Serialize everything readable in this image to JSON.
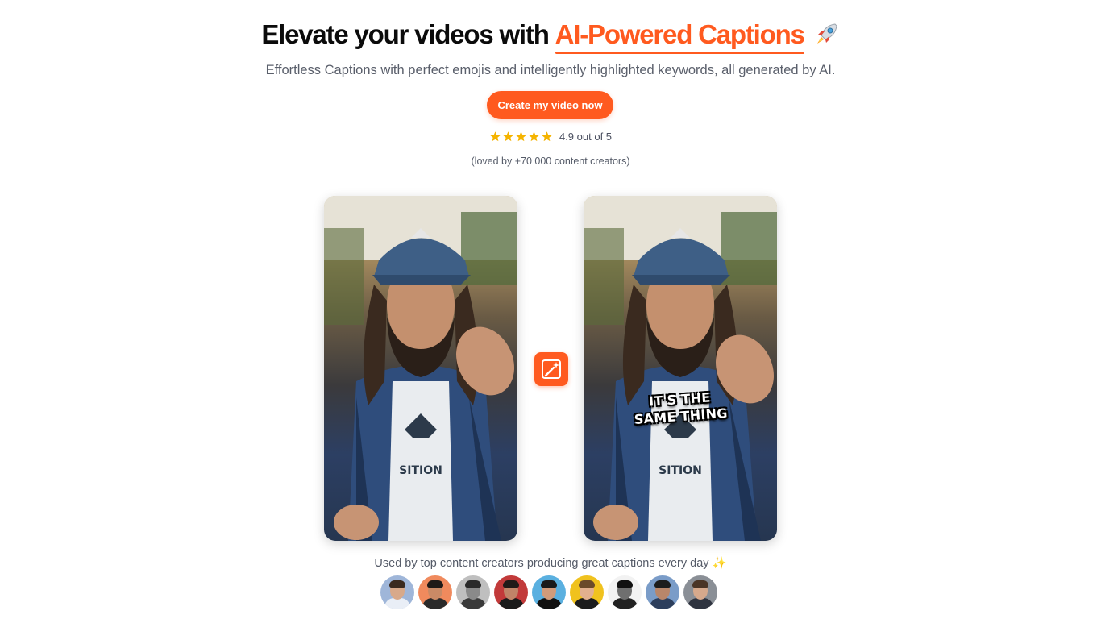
{
  "hero": {
    "title_prefix": "Elevate your videos with ",
    "title_accent": "AI-Powered Captions",
    "subtitle": "Effortless Captions with perfect emojis and intelligently highlighted keywords, all generated by AI."
  },
  "cta": {
    "label": "Create my video now"
  },
  "rating": {
    "stars": 5,
    "text": "4.9 out of 5",
    "loved_text": "(loved by +70 000 content creators)"
  },
  "videos": {
    "after_caption_line1": "IT'S THE",
    "after_caption_line2": "SAME THING"
  },
  "social_proof": {
    "text": "Used by top content creators producing great captions every day ✨",
    "avatars": [
      {
        "bg": "#9fb6d9",
        "skin": "#d8a98a",
        "hair": "#3a2a1f",
        "shirt": "#e9eef6"
      },
      {
        "bg": "#f08a5d",
        "skin": "#c98a66",
        "hair": "#1f1a17",
        "shirt": "#2a2a2a"
      },
      {
        "bg": "#bfbfbf",
        "skin": "#8a8a8a",
        "hair": "#2a2a2a",
        "shirt": "#3a3a3a"
      },
      {
        "bg": "#c23a3a",
        "skin": "#c08468",
        "hair": "#201a18",
        "shirt": "#1b1b1b"
      },
      {
        "bg": "#5ab0e0",
        "skin": "#d19b7a",
        "hair": "#1a1a1a",
        "shirt": "#111111"
      },
      {
        "bg": "#f0c21e",
        "skin": "#e2b08e",
        "hair": "#6b4a2a",
        "shirt": "#1c1c1c"
      },
      {
        "bg": "#f2f2f2",
        "skin": "#6f6f6f",
        "hair": "#111111",
        "shirt": "#222222"
      },
      {
        "bg": "#7a9cc8",
        "skin": "#b8866a",
        "hair": "#1c1c1c",
        "shirt": "#2c3e5c"
      },
      {
        "bg": "#8a8f96",
        "skin": "#d6a98c",
        "hair": "#4a3526",
        "shirt": "#2f3440"
      }
    ]
  },
  "colors": {
    "accent": "#ff5a1f",
    "star": "#f5b400"
  }
}
